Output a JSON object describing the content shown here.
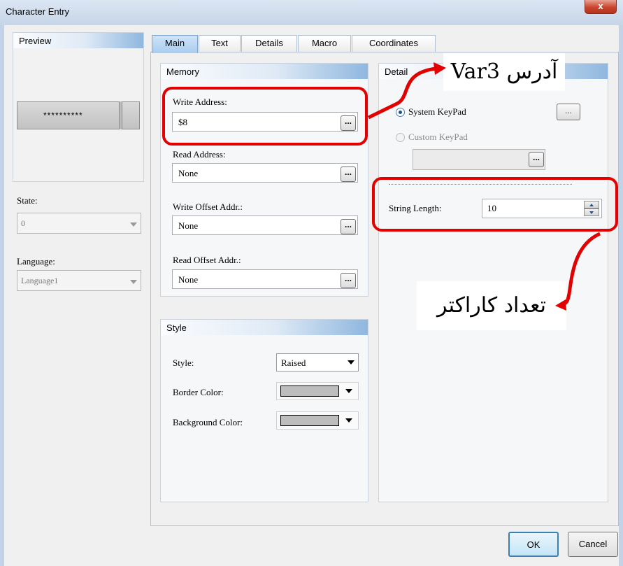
{
  "window": {
    "title": "Character Entry",
    "close_glyph": "x"
  },
  "preview": {
    "header": "Preview",
    "sample_text": "**********"
  },
  "left": {
    "state_label": "State:",
    "state_value": "0",
    "language_label": "Language:",
    "language_value": "Language1"
  },
  "tabs": [
    "Main",
    "Text",
    "Details",
    "Macro",
    "Coordinates"
  ],
  "memory": {
    "header": "Memory",
    "write_address_label": "Write Address:",
    "write_address_value": "$8",
    "read_address_label": "Read Address:",
    "read_address_value": "None",
    "write_offset_label": "Write Offset Addr.:",
    "write_offset_value": "None",
    "read_offset_label": "Read Offset Addr.:",
    "read_offset_value": "None",
    "browse_label": "..."
  },
  "detail": {
    "header": "Detail",
    "system_keypad": "System KeyPad",
    "custom_keypad": "Custom KeyPad",
    "browse_label": "...",
    "string_length_label": "String Length:",
    "string_length_value": "10"
  },
  "style": {
    "header": "Style",
    "style_label": "Style:",
    "style_value": "Raised",
    "border_color_label": "Border Color:",
    "background_color_label": "Background Color:"
  },
  "buttons": {
    "ok": "OK",
    "cancel": "Cancel"
  },
  "annotations": {
    "address": "آدرس Var3",
    "char_count": "تعداد کاراکتر"
  },
  "colors": {
    "annotation_red": "#e30000",
    "header_blue": "#8fb7df",
    "swatch_gray": "#bdbdbd"
  }
}
